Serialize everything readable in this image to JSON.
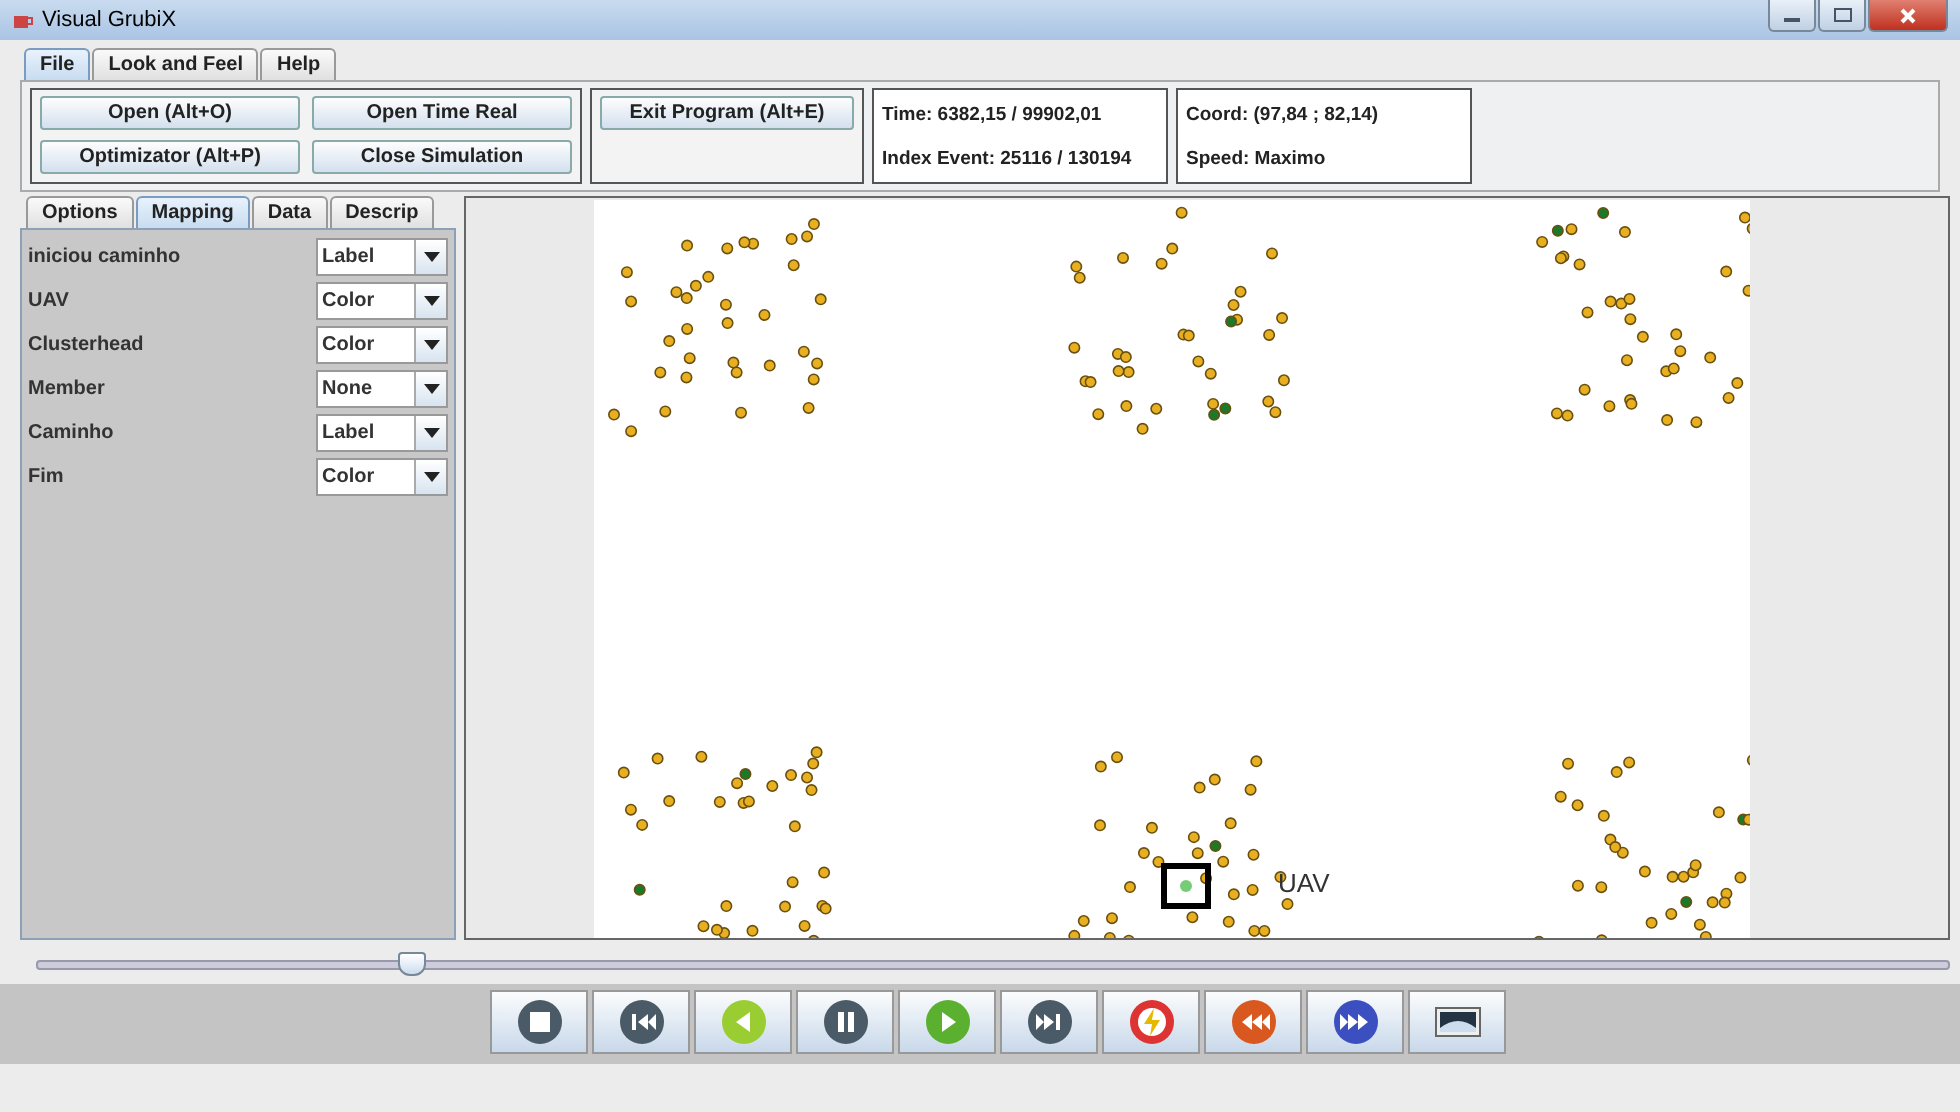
{
  "window": {
    "title": "Visual GrubiX"
  },
  "menu_tabs": [
    {
      "label": "File",
      "selected": true
    },
    {
      "label": "Look and Feel",
      "selected": false
    },
    {
      "label": "Help",
      "selected": false
    }
  ],
  "toolbar": {
    "buttons": [
      {
        "label": "**O**pen (Alt+O)"
      },
      {
        "label": "Open **T**ime Real"
      },
      {
        "label": "Op**t**imizator (Alt+P)"
      },
      {
        "label": "**C**lose Simulation"
      }
    ],
    "exit_button": "**E**xit Program (Alt+E)",
    "time": "Time: 6382,15 / 99902,01",
    "index_event": "Index Event: 25116 / 130194",
    "coord": "Coord: (97,84 ; 82,14)",
    "speed": "Speed: Maximo"
  },
  "side_tabs": [
    {
      "label": "Options",
      "selected": false
    },
    {
      "label": "Mapping",
      "selected": true
    },
    {
      "label": "Data",
      "selected": false
    },
    {
      "label": "Descrip",
      "selected": false
    }
  ],
  "mappings": [
    {
      "name": "iniciou caminho",
      "value": "Label"
    },
    {
      "name": "UAV",
      "value": "Color"
    },
    {
      "name": "Clusterhead",
      "value": "Color"
    },
    {
      "name": "Member",
      "value": "None"
    },
    {
      "name": "Caminho",
      "value": "Label"
    },
    {
      "name": "Fim",
      "value": "Color"
    }
  ],
  "canvas": {
    "uav_label": "UAV"
  },
  "timeline": {
    "level": 0.196
  },
  "controls": [
    {
      "kind": "stop"
    },
    {
      "kind": "skip-back"
    },
    {
      "kind": "back"
    },
    {
      "kind": "pause"
    },
    {
      "kind": "play"
    },
    {
      "kind": "skip-forward"
    },
    {
      "kind": "flash"
    },
    {
      "kind": "rewind"
    },
    {
      "kind": "fast-forward"
    },
    {
      "kind": "screen"
    }
  ]
}
